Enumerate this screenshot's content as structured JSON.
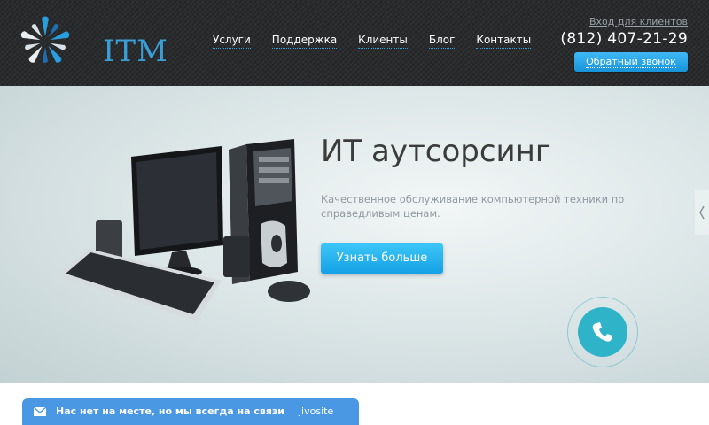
{
  "header": {
    "logo_text": "ITM",
    "nav": [
      "Услуги",
      "Поддержка",
      "Клиенты",
      "Блог",
      "Контакты"
    ],
    "client_link": "Вход для клиентов",
    "phone": "(812) 407-21-29",
    "callback_label": "Обратный звонок"
  },
  "hero": {
    "title": "ИТ аутсорсинг",
    "text": "Качественное обслуживание компьютерной техники по справедливым ценам.",
    "button_label": "Узнать больше"
  },
  "chat": {
    "text": "Нас нет на месте, но мы всегда на связи",
    "brand": "jivosite"
  },
  "colors": {
    "accent": "#1ea6ea",
    "header_bg": "#2b2c2e",
    "call_button": "#2fb3c9",
    "chat_bg": "#4a97e3"
  },
  "icons": [
    "logo-burst-icon",
    "chevron-left-icon",
    "phone-icon",
    "mail-icon"
  ]
}
